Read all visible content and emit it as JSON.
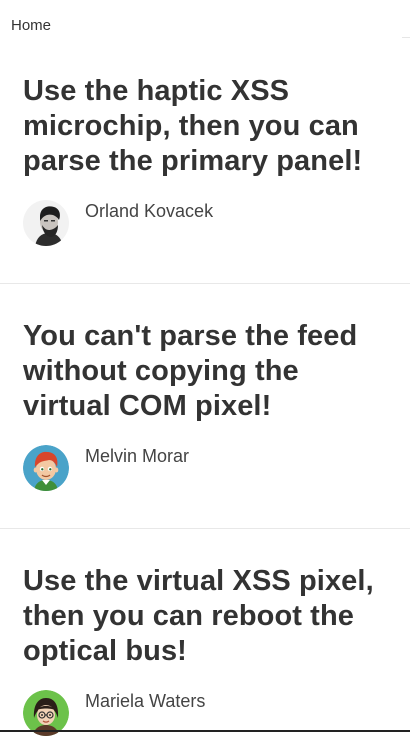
{
  "nav": {
    "breadcrumb": "Home"
  },
  "posts": [
    {
      "title": "Use the haptic XSS microchip, then you can parse the primary panel!",
      "author": "Orland Kovacek"
    },
    {
      "title": "You can't parse the feed without copying the virtual COM pixel!",
      "author": "Melvin Morar"
    },
    {
      "title": "Use the virtual XSS pixel, then you can reboot the optical bus!",
      "author": "Mariela Waters"
    }
  ]
}
